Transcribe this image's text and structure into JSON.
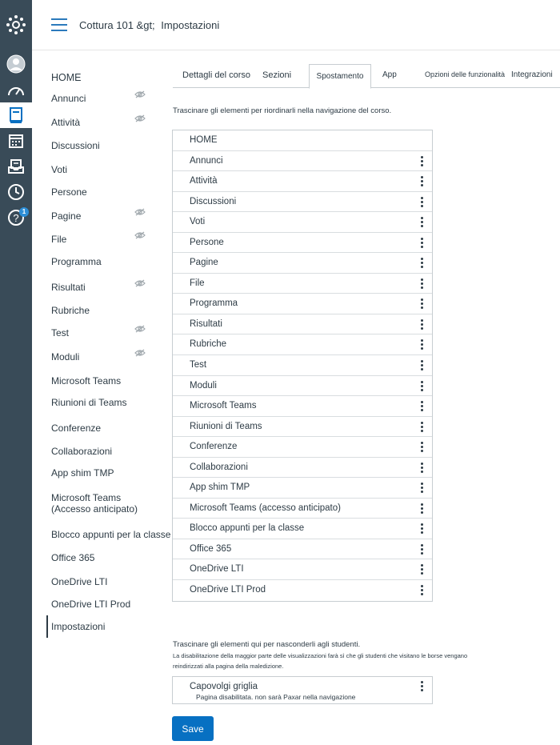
{
  "app": {
    "logo_icon": "canvas-logo-icon"
  },
  "rail": {
    "items": [
      {
        "name": "account",
        "icon": "account-icon"
      },
      {
        "name": "dashboard",
        "icon": "dashboard-icon"
      },
      {
        "name": "courses",
        "icon": "courses-icon"
      },
      {
        "name": "calendar",
        "icon": "calendar-icon"
      },
      {
        "name": "inbox",
        "icon": "inbox-icon"
      },
      {
        "name": "history",
        "icon": "history-icon"
      },
      {
        "name": "help",
        "icon": "help-icon"
      }
    ],
    "help_badge": "1"
  },
  "header": {
    "breadcrumb_course": "Cottura 101 &gt;",
    "breadcrumb_page": "Impostazioni"
  },
  "leftnav": {
    "items": [
      {
        "label": "HOME",
        "hidden": false
      },
      {
        "label": "Annunci",
        "hidden": true
      },
      {
        "label": "Attività",
        "hidden": true
      },
      {
        "label": "Discussioni",
        "hidden": false
      },
      {
        "label": "Voti",
        "hidden": false
      },
      {
        "label": "Persone",
        "hidden": false
      },
      {
        "label": "Pagine",
        "hidden": true
      },
      {
        "label": "File",
        "hidden": true
      },
      {
        "label": "Programma",
        "hidden": false
      },
      {
        "label": "Risultati",
        "hidden": true
      },
      {
        "label": "Rubriche",
        "hidden": false
      },
      {
        "label": "Test",
        "hidden": true
      },
      {
        "label": "Moduli",
        "hidden": true
      },
      {
        "label": "Microsoft Teams",
        "hidden": false
      },
      {
        "label": "Riunioni di Teams",
        "hidden": false
      },
      {
        "label": "Conferenze",
        "hidden": false
      },
      {
        "label": "Collaborazioni",
        "hidden": false
      },
      {
        "label": "App shim TMP",
        "hidden": false
      },
      {
        "label": "Microsoft Teams",
        "hidden": false
      },
      {
        "label": "(Accesso anticipato)",
        "hidden": false
      },
      {
        "label": "Blocco appunti per la classe",
        "hidden": false
      },
      {
        "label": "Office 365",
        "hidden": false
      },
      {
        "label": "OneDrive LTI",
        "hidden": false
      },
      {
        "label": "OneDrive LTI Prod",
        "hidden": false
      },
      {
        "label": "Impostazioni",
        "hidden": false
      }
    ]
  },
  "tabs": [
    {
      "label": "Dettagli del corso"
    },
    {
      "label": "Sezioni"
    },
    {
      "label": "Spostamento"
    },
    {
      "label": "App"
    },
    {
      "label": "Opzioni delle funzionalità"
    },
    {
      "label": "Integrazioni"
    }
  ],
  "navigation": {
    "instructions": "Trascinare gli elementi per riordinarli nella navigazione del corso.",
    "items": [
      "HOME",
      "Annunci",
      "Attività",
      "Discussioni",
      "Voti",
      "Persone",
      "Pagine",
      "File",
      "Programma",
      "Risultati",
      "Rubriche",
      "Test",
      "Moduli",
      "Microsoft Teams",
      "Riunioni di Teams",
      "Conferenze",
      "Collaborazioni",
      "App shim TMP",
      "Microsoft Teams (accesso anticipato)",
      "Blocco appunti per la classe",
      "Office 365",
      "OneDrive LTI",
      "OneDrive LTI Prod"
    ],
    "hide_title": "Trascinare gli elementi qui per nasconderli agli studenti.",
    "hide_note": "La disabilitazione della maggior parte delle visualizzazioni farà sì che gli studenti che visitano le borse vengano reindirizzati alla pagina della maledizione.",
    "hidden_items": [
      {
        "label": "Capovolgi griglia",
        "sub": "Pagina disabilitata. non sarà Paxar nella navigazione"
      }
    ]
  },
  "actions": {
    "save_label": "Save"
  },
  "colors": {
    "rail": "#394b58",
    "accent": "#0770c2",
    "text": "#2d3b45"
  }
}
